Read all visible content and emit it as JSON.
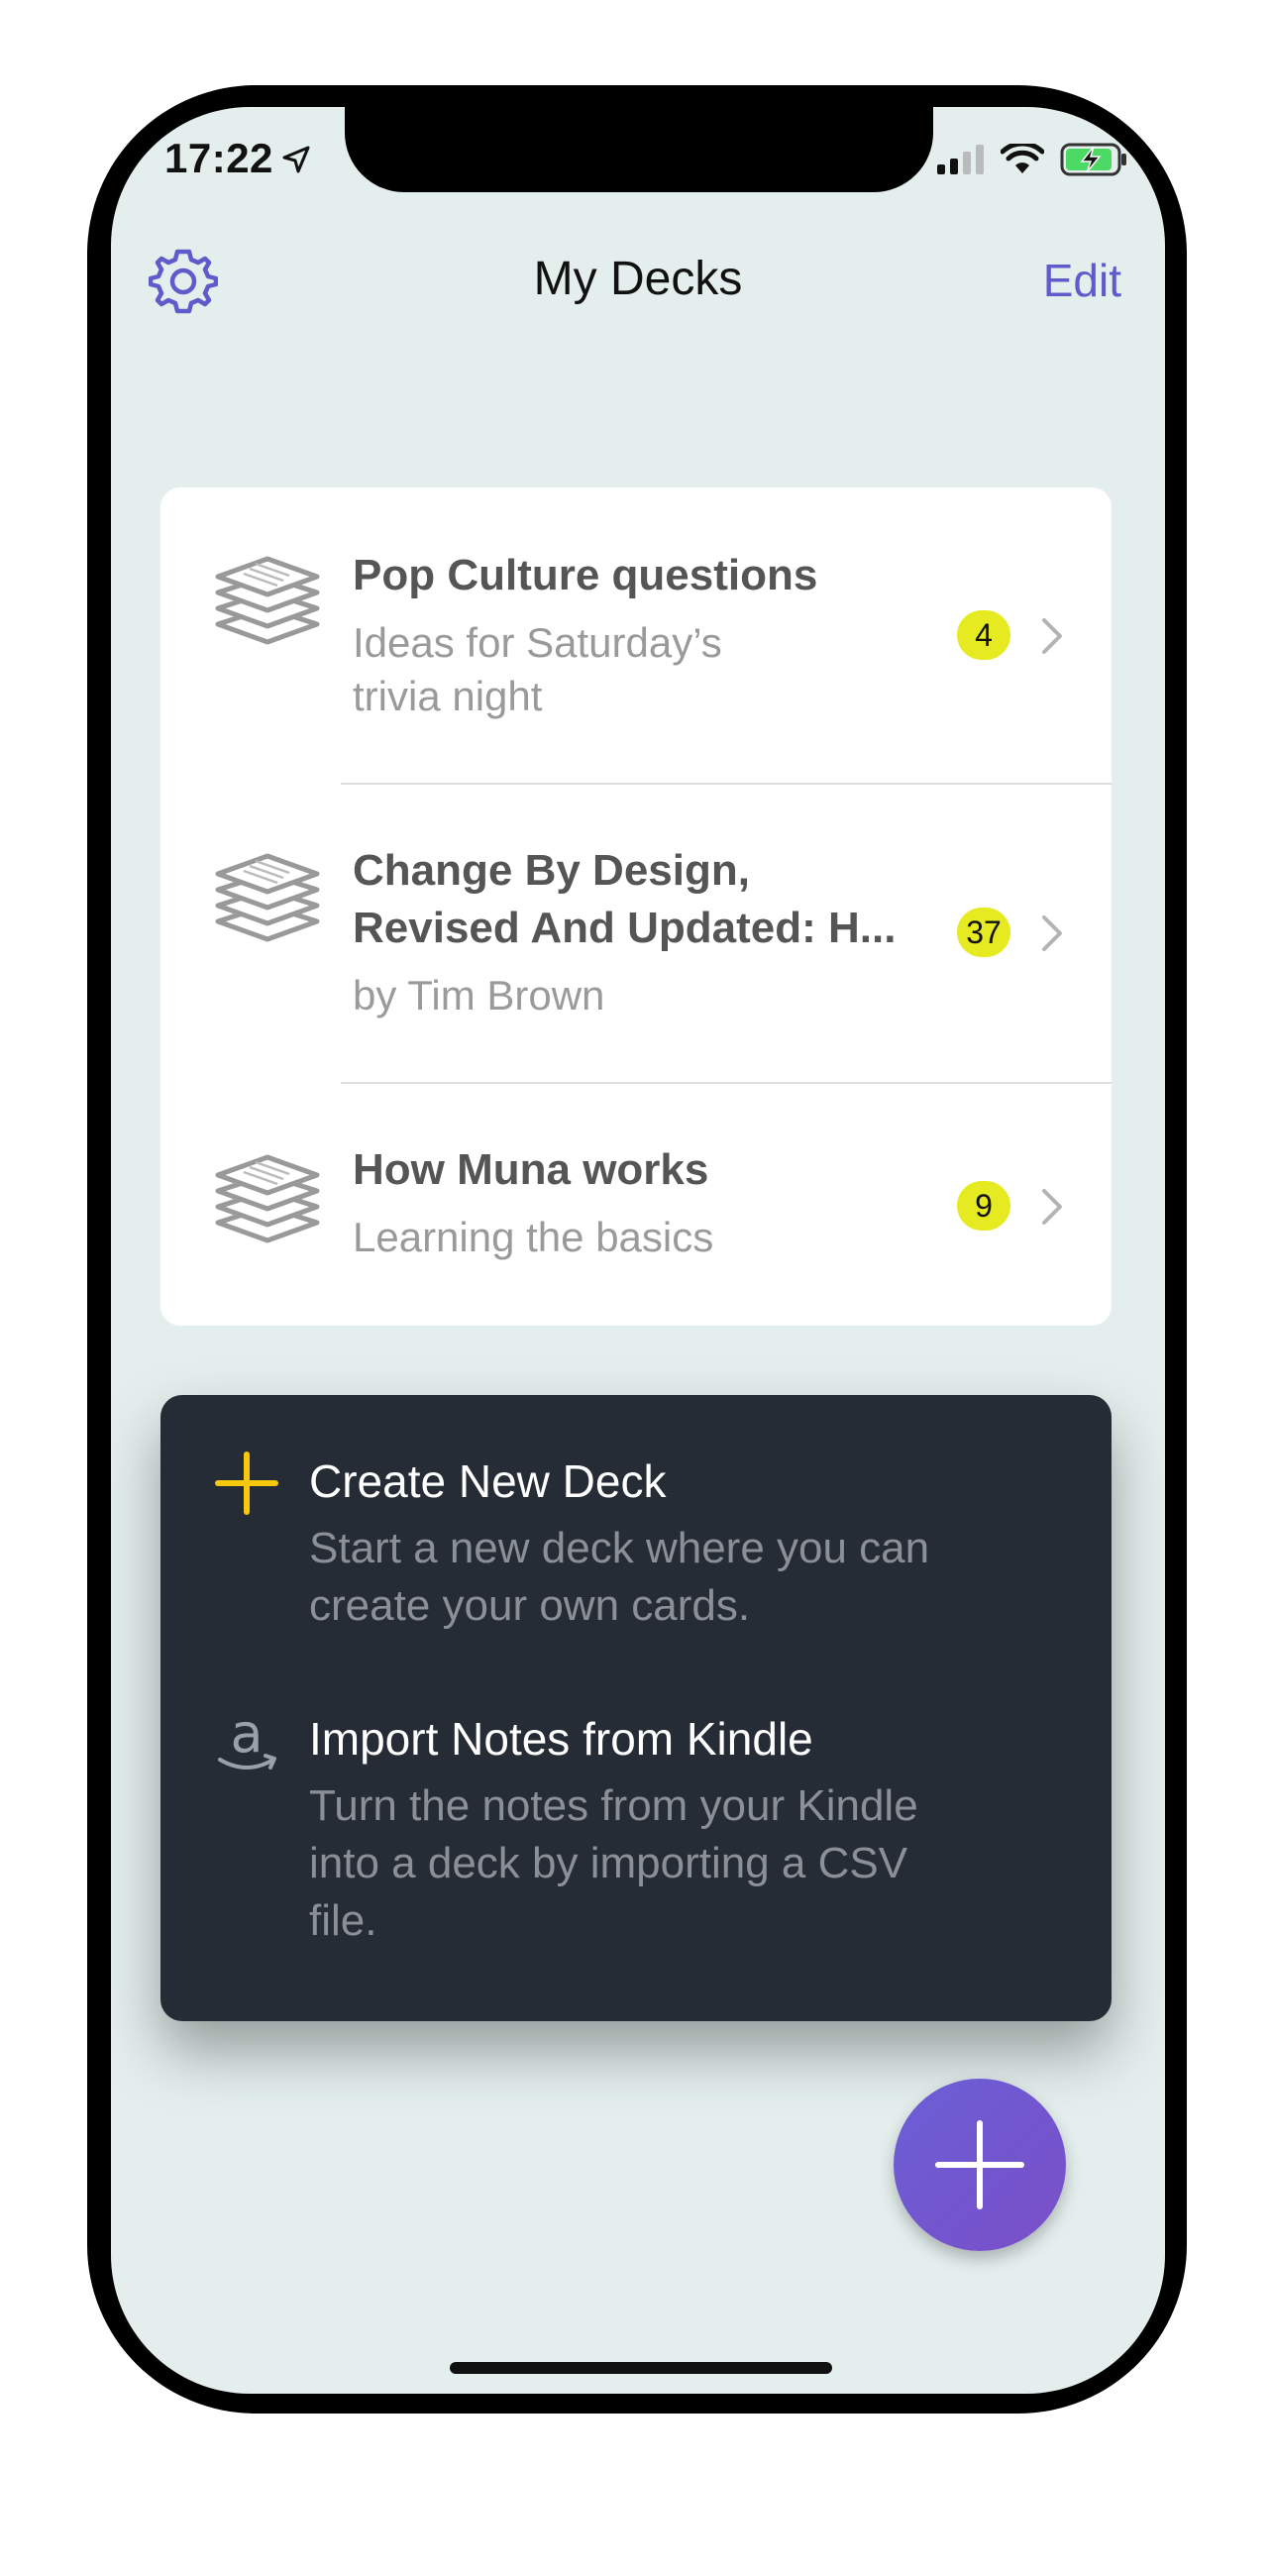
{
  "status_bar": {
    "time": "17:22"
  },
  "nav": {
    "title": "My Decks",
    "edit_label": "Edit"
  },
  "decks": [
    {
      "title": "Pop Culture questions",
      "subtitle_line1": "Ideas for Saturday’s",
      "subtitle_line2": "trivia night",
      "count": "4"
    },
    {
      "title_line1": "Change By Design,",
      "title_line2": "Revised And Updated: H...",
      "subtitle": "by Tim Brown",
      "count": "37"
    },
    {
      "title": "How Muna works",
      "subtitle": "Learning the basics",
      "count": "9"
    }
  ],
  "menu": {
    "create": {
      "title": "Create New Deck",
      "desc_line1": "Start a new deck where you can",
      "desc_line2": "create your own cards."
    },
    "import": {
      "title": "Import Notes from Kindle",
      "desc_line1": "Turn the notes from your Kindle",
      "desc_line2": "into a deck by importing a CSV",
      "desc_line3": "file."
    }
  },
  "colors": {
    "accent": "#5f5bcc",
    "badge": "#e6ea20",
    "menu_bg": "#262c35",
    "screen_bg": "#e4efed",
    "plus_yellow": "#f6c90e"
  },
  "icons": [
    "gear-icon",
    "deck-stack-icon",
    "chevron-right-icon",
    "plus-icon",
    "amazon-icon",
    "location-arrow-icon",
    "signal-icon",
    "wifi-icon",
    "battery-charging-icon"
  ]
}
